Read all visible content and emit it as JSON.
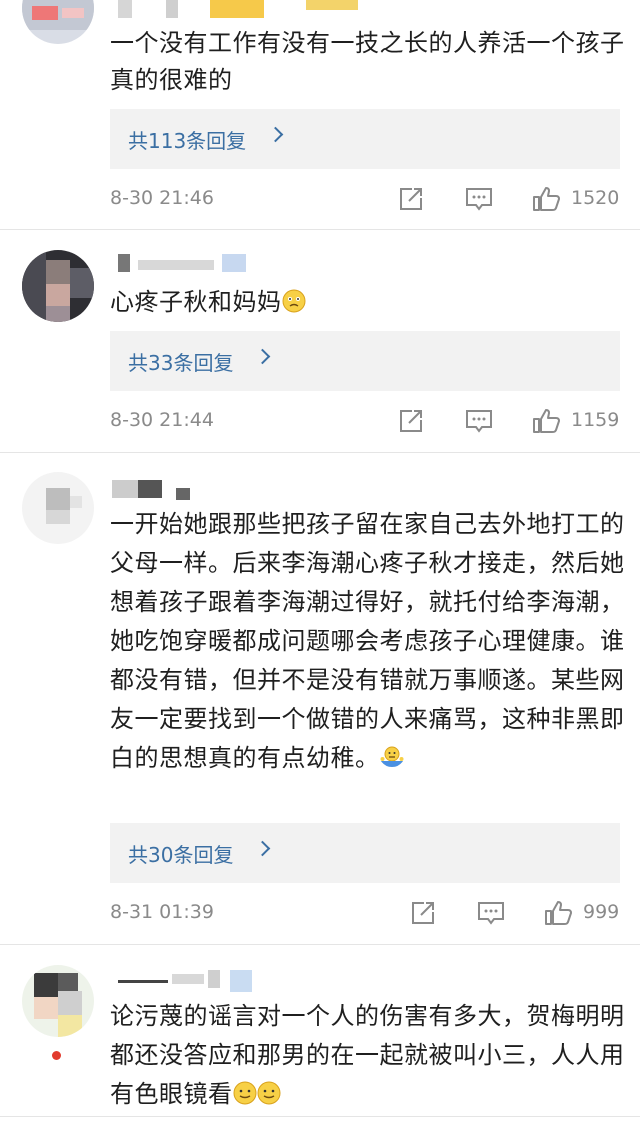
{
  "comments": [
    {
      "text": "一个没有工作有没有一技之长的人养活一个孩子真的很难的",
      "reply_label": "共113条回复",
      "time": "8-30 21:46",
      "likes": "1520"
    },
    {
      "text": "心疼子秋和妈妈",
      "emoji": "sad-emoji",
      "reply_label": "共33条回复",
      "time": "8-30 21:44",
      "likes": "1159"
    },
    {
      "text": "一开始她跟那些把孩子留在家自己去外地打工的父母一样。后来李海潮心疼子秋才接走，然后她想着孩子跟着李海潮过得好，就托付给李海潮，她吃饱穿暖都成问题哪会考虑孩子心理健康。谁都没有错，但并不是没有错就万事顺遂。某些网友一定要找到一个做错的人来痛骂，这种非黑即白的思想真的有点幼稚。",
      "emoji": "shrug-emoji",
      "reply_label": "共30条回复",
      "time": "8-31 01:39",
      "likes": "999"
    },
    {
      "text": "论污蔑的谣言对一个人的伤害有多大，贺梅明明都还没答应和那男的在一起就被叫小三，人人用有色眼镜看",
      "emoji": "smile-emoji"
    }
  ],
  "icons": {
    "share": "share-icon",
    "comment": "comment-icon",
    "like": "thumbs-up-icon",
    "chevron": "chevron-right-icon"
  },
  "colors": {
    "reply_link": "#3b6fa3",
    "meta_gray": "#8a8a8a",
    "reply_bg": "#f2f2f2"
  }
}
